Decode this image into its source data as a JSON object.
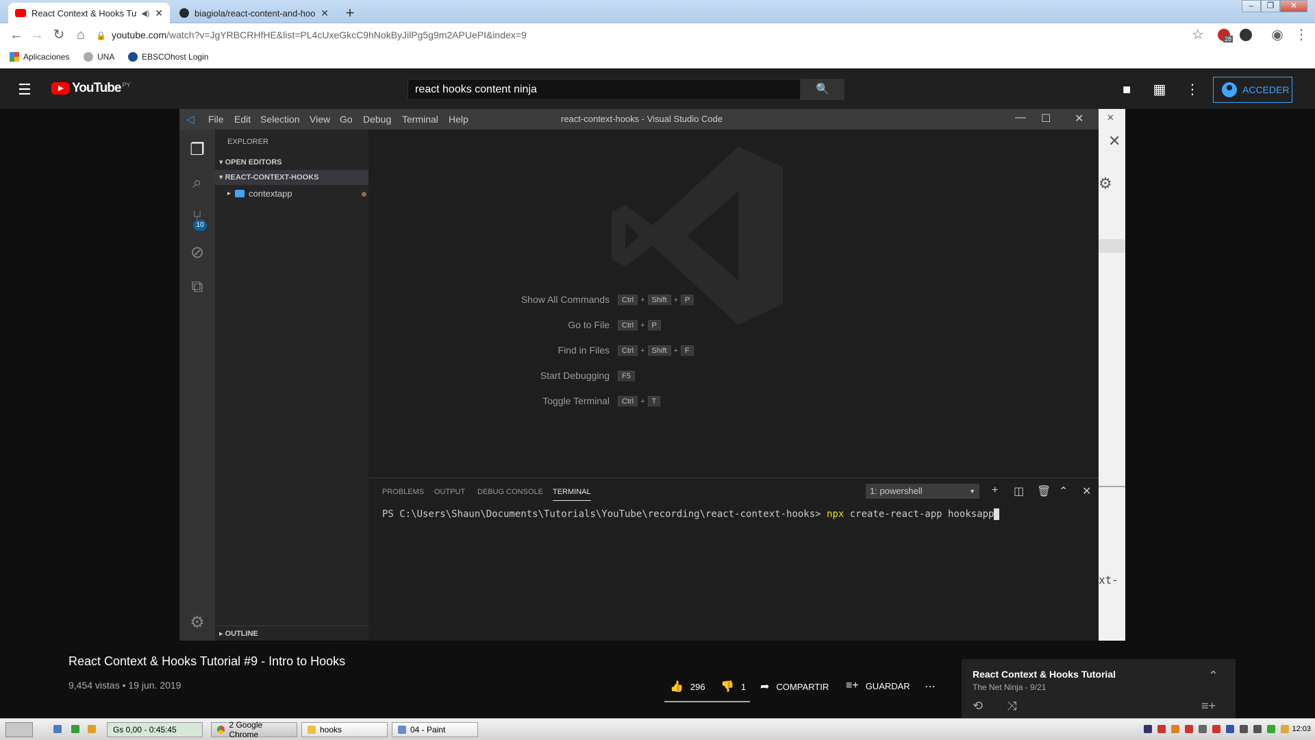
{
  "browser": {
    "tabs": [
      {
        "title": "React Context & Hooks Tuto",
        "active": true
      },
      {
        "title": "biagiola/react-content-and-hook",
        "active": false
      }
    ],
    "new_tab": "+",
    "url_host": "youtube.com",
    "url_path": "/watch?v=JgYRBCRHfHE&list=PL4cUxeGkcC9hNokByJilPg5g9m2APUePI&index=9",
    "bookmarks": [
      "Aplicaciones",
      "UNA",
      "EBSCOhost Login"
    ],
    "extension_badge": "28",
    "window_controls": [
      "–",
      "❐",
      "✕"
    ]
  },
  "youtube": {
    "logo_text": "YouTube",
    "country_code": "PY",
    "search_query": "react hooks content ninja",
    "signin_label": "ACCEDER"
  },
  "vscode": {
    "menu": [
      "File",
      "Edit",
      "Selection",
      "View",
      "Go",
      "Debug",
      "Terminal",
      "Help"
    ],
    "window_title": "react-context-hooks - Visual Studio Code",
    "explorer_header": "EXPLORER",
    "open_editors": "OPEN EDITORS",
    "project": "REACT-CONTEXT-HOOKS",
    "folder": "contextapp",
    "outline": "OUTLINE",
    "scm_badge": "10",
    "shortcuts": [
      {
        "label": "Show All Commands",
        "keys": [
          "Ctrl",
          "+",
          "Shift",
          "+",
          "P"
        ]
      },
      {
        "label": "Go to File",
        "keys": [
          "Ctrl",
          "+",
          "P"
        ]
      },
      {
        "label": "Find in Files",
        "keys": [
          "Ctrl",
          "+",
          "Shift",
          "+",
          "F"
        ]
      },
      {
        "label": "Start Debugging",
        "keys": [
          "F5"
        ]
      },
      {
        "label": "Toggle Terminal",
        "keys": [
          "Ctrl",
          "+",
          "T"
        ]
      }
    ],
    "panel_tabs": [
      "PROBLEMS",
      "OUTPUT",
      "DEBUG CONSOLE",
      "TERMINAL"
    ],
    "shell": "1: powershell",
    "prompt": "PS C:\\Users\\Shaun\\Documents\\Tutorials\\YouTube\\recording\\react-context-hooks> ",
    "cmd_npx": "npx",
    "cmd_rest": " create-react-app hooksapp"
  },
  "overlay_text": "xt-",
  "video": {
    "title": "React Context & Hooks Tutorial #9 - Intro to Hooks",
    "meta": "9,454 vistas • 19 jun. 2019",
    "likes": "296",
    "dislikes": "1",
    "share": "COMPARTIR",
    "save": "GUARDAR"
  },
  "playlist": {
    "title": "React Context & Hooks Tutorial",
    "subtitle": "The Net Ninja - 9/21"
  },
  "taskbar": {
    "gs": "Gs 0,00 - 0:45:45",
    "items": [
      "2 Google Chrome",
      "hooks",
      "04 - Paint"
    ],
    "clock": "12:03"
  }
}
